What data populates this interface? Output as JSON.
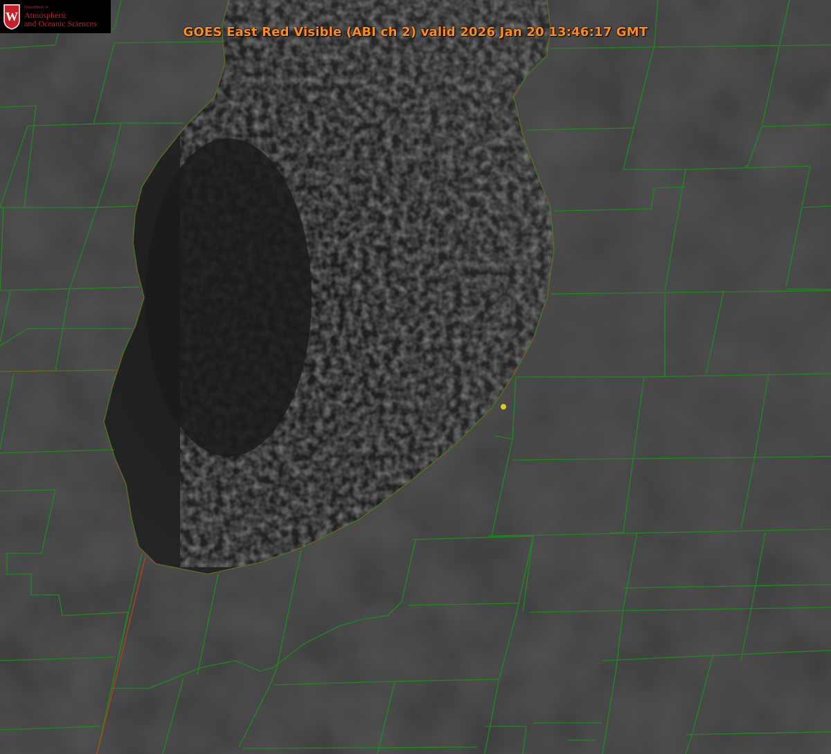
{
  "title": "GOES East Red Visible (ABI ch 2) valid 2026 Jan 20 13:46:17 GMT",
  "logo": {
    "department": "Department of",
    "line1": "Atmospheric",
    "line2": "and Oceanic Sciences",
    "seal_letter": "W"
  },
  "colors": {
    "land": "#3a3a3a",
    "lake": "#1e1e1e",
    "county_lines": "#1f8a1f",
    "shoreline": "#e0302a",
    "title": "#ff8c1a",
    "marker": "#d8d020",
    "logo_red": "#c8202a"
  },
  "map": {
    "imagery": "grayscale satellite visible",
    "feature": "lake-effect cloud streets over southern lake",
    "marker": "yellow-dot"
  }
}
